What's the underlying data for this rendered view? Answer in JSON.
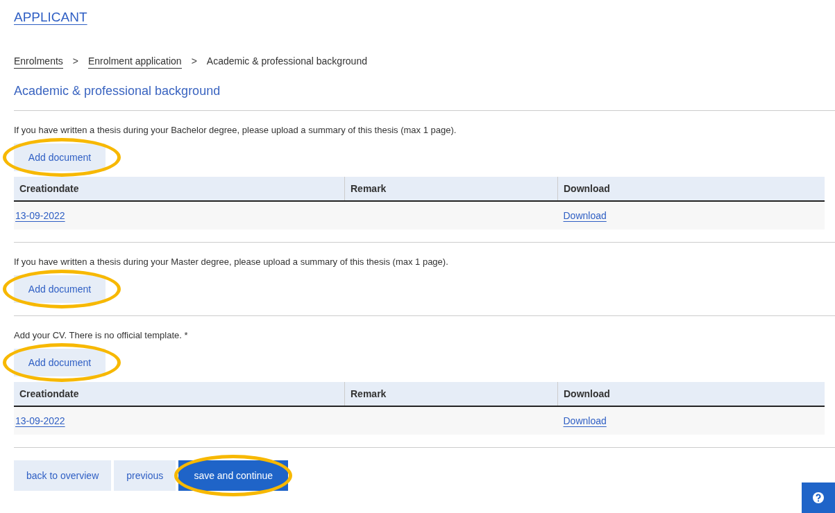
{
  "header": {
    "title": "APPLICANT"
  },
  "breadcrumb": [
    {
      "label": "Enrolments",
      "link": true
    },
    {
      "label": "Enrolment application",
      "link": true
    },
    {
      "label": "Academic & professional background",
      "link": false
    }
  ],
  "breadcrumb_separator": ">",
  "heading": "Academic & professional background",
  "sections": [
    {
      "instruction": "If you have written a thesis during your Bachelor degree, please upload a summary of this thesis (max 1 page).",
      "add_button": {
        "label": "Add document",
        "highlighted": true
      },
      "table": {
        "columns": [
          "Creationdate",
          "Remark",
          "Download"
        ],
        "rows": [
          {
            "date": "13-09-2022",
            "download": "Download"
          }
        ]
      }
    },
    {
      "instruction": "If you have written a thesis during your Master degree, please upload a summary of this thesis (max 1 page).",
      "add_button": {
        "label": "Add document",
        "highlighted": true
      }
    },
    {
      "instruction": "Add your CV. There is no official template. *",
      "add_button": {
        "label": "Add document",
        "highlighted": true
      },
      "table": {
        "columns": [
          "Creationdate",
          "Remark",
          "Download"
        ],
        "rows": [
          {
            "date": "13-09-2022",
            "download": "Download"
          }
        ]
      }
    }
  ],
  "footer_buttons": [
    {
      "label": "back to overview",
      "kind": "secondary",
      "highlighted": false
    },
    {
      "label": "previous",
      "kind": "secondary",
      "highlighted": false
    },
    {
      "label": "save and continue",
      "kind": "primary",
      "highlighted": true
    }
  ]
}
